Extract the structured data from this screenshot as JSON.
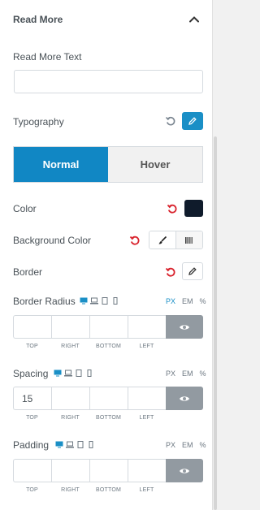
{
  "section": {
    "title": "Read More"
  },
  "read_more_text": {
    "label": "Read More Text",
    "value": "",
    "placeholder": ""
  },
  "typography": {
    "label": "Typography"
  },
  "tabs": [
    {
      "label": "Normal"
    },
    {
      "label": "Hover"
    }
  ],
  "color": {
    "label": "Color",
    "value": "#0f1b2b"
  },
  "background_color": {
    "label": "Background Color"
  },
  "border": {
    "label": "Border"
  },
  "border_radius": {
    "label": "Border Radius",
    "units": [
      "PX",
      "EM",
      "%"
    ],
    "active_unit": "PX",
    "fields": {
      "top": "",
      "right": "",
      "bottom": "",
      "left": ""
    },
    "field_labels": [
      "TOP",
      "RIGHT",
      "BOTTOM",
      "LEFT"
    ]
  },
  "spacing": {
    "label": "Spacing",
    "units": [
      "PX",
      "EM",
      "%"
    ],
    "active_unit": "PX",
    "fields": {
      "top": "15",
      "right": "",
      "bottom": "",
      "left": ""
    },
    "field_labels": [
      "TOP",
      "RIGHT",
      "BOTTOM",
      "LEFT"
    ]
  },
  "padding": {
    "label": "Padding",
    "units": [
      "PX",
      "EM",
      "%"
    ],
    "active_unit": "PX",
    "fields": {
      "top": "",
      "right": "",
      "bottom": "",
      "left": ""
    },
    "field_labels": [
      "TOP",
      "RIGHT",
      "BOTTOM",
      "LEFT"
    ]
  },
  "colors": {
    "accent": "#1187c4",
    "reset": "#d9232d",
    "link_button": "#929aa1"
  },
  "icons": [
    "chevron-up-icon",
    "reset-icon",
    "pencil-icon",
    "brush-icon",
    "gradient-icon",
    "desktop-icon",
    "laptop-icon",
    "tablet-icon",
    "mobile-icon",
    "eye-icon"
  ]
}
